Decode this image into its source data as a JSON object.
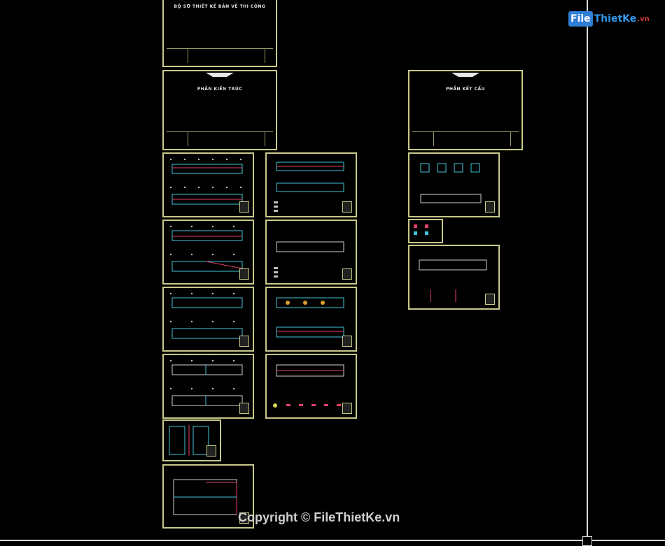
{
  "logo": {
    "part1": "File",
    "part2": "ThietKe",
    "part3": ".vn"
  },
  "covers": [
    {
      "title": "BỘ SƠ THIẾT KẾ BẢN VẼ THI CÔNG"
    },
    {
      "title": "PHẦN KIẾN TRÚC"
    },
    {
      "title": "PHẦN KẾT CẤU"
    }
  ],
  "watermark": "Copyright © FileThietKe.vn",
  "colors": {
    "background": "#000000",
    "frame": "#c8c88a",
    "crosshair": "#d9d9d9",
    "plan_cyan": "#3fc6d8",
    "plan_red": "#e0406a"
  }
}
